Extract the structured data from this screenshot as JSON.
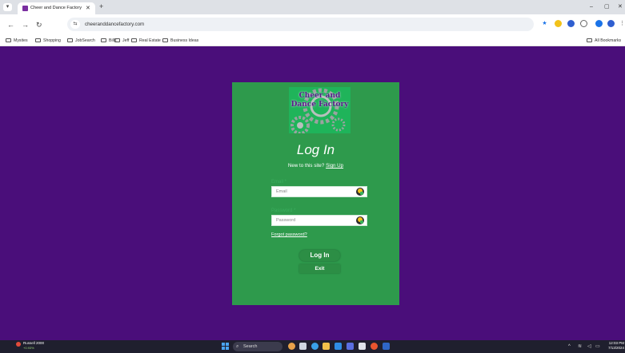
{
  "browser": {
    "tab_title": "Cheer and Dance Factory | ora",
    "tab_close": "✕",
    "new_tab": "+",
    "url": "cheeranddancefactory.com",
    "window_controls": [
      "–",
      "▢",
      "✕"
    ],
    "nav": {
      "back": "←",
      "forward": "→",
      "reload": "↻"
    },
    "bookmarks": [
      "Mysites",
      "Shopping",
      "JobSearch",
      "Bills",
      "Jeff",
      "Real Estate",
      "Business Ideas"
    ],
    "all_bookmarks": "All Bookmarks"
  },
  "page": {
    "background_color": "#4a0e7a",
    "card_color": "#2e9a4c",
    "logo_text": "Cheer and Dance Factory",
    "title": "Log In",
    "signup_prompt": "New to this site?",
    "signup_link": "Sign Up",
    "email_label": "Email *",
    "email_placeholder": "Email",
    "password_label": "Password *",
    "password_placeholder": "Password",
    "forgot_password": "Forgot password?",
    "login_button": "Log In",
    "exit_button": "Exit"
  },
  "taskbar": {
    "widget_title": "Russell 2000",
    "widget_sub": "+0.93%",
    "search_placeholder": "Search",
    "time": "12:03 PM",
    "date": "7/13/2024"
  }
}
